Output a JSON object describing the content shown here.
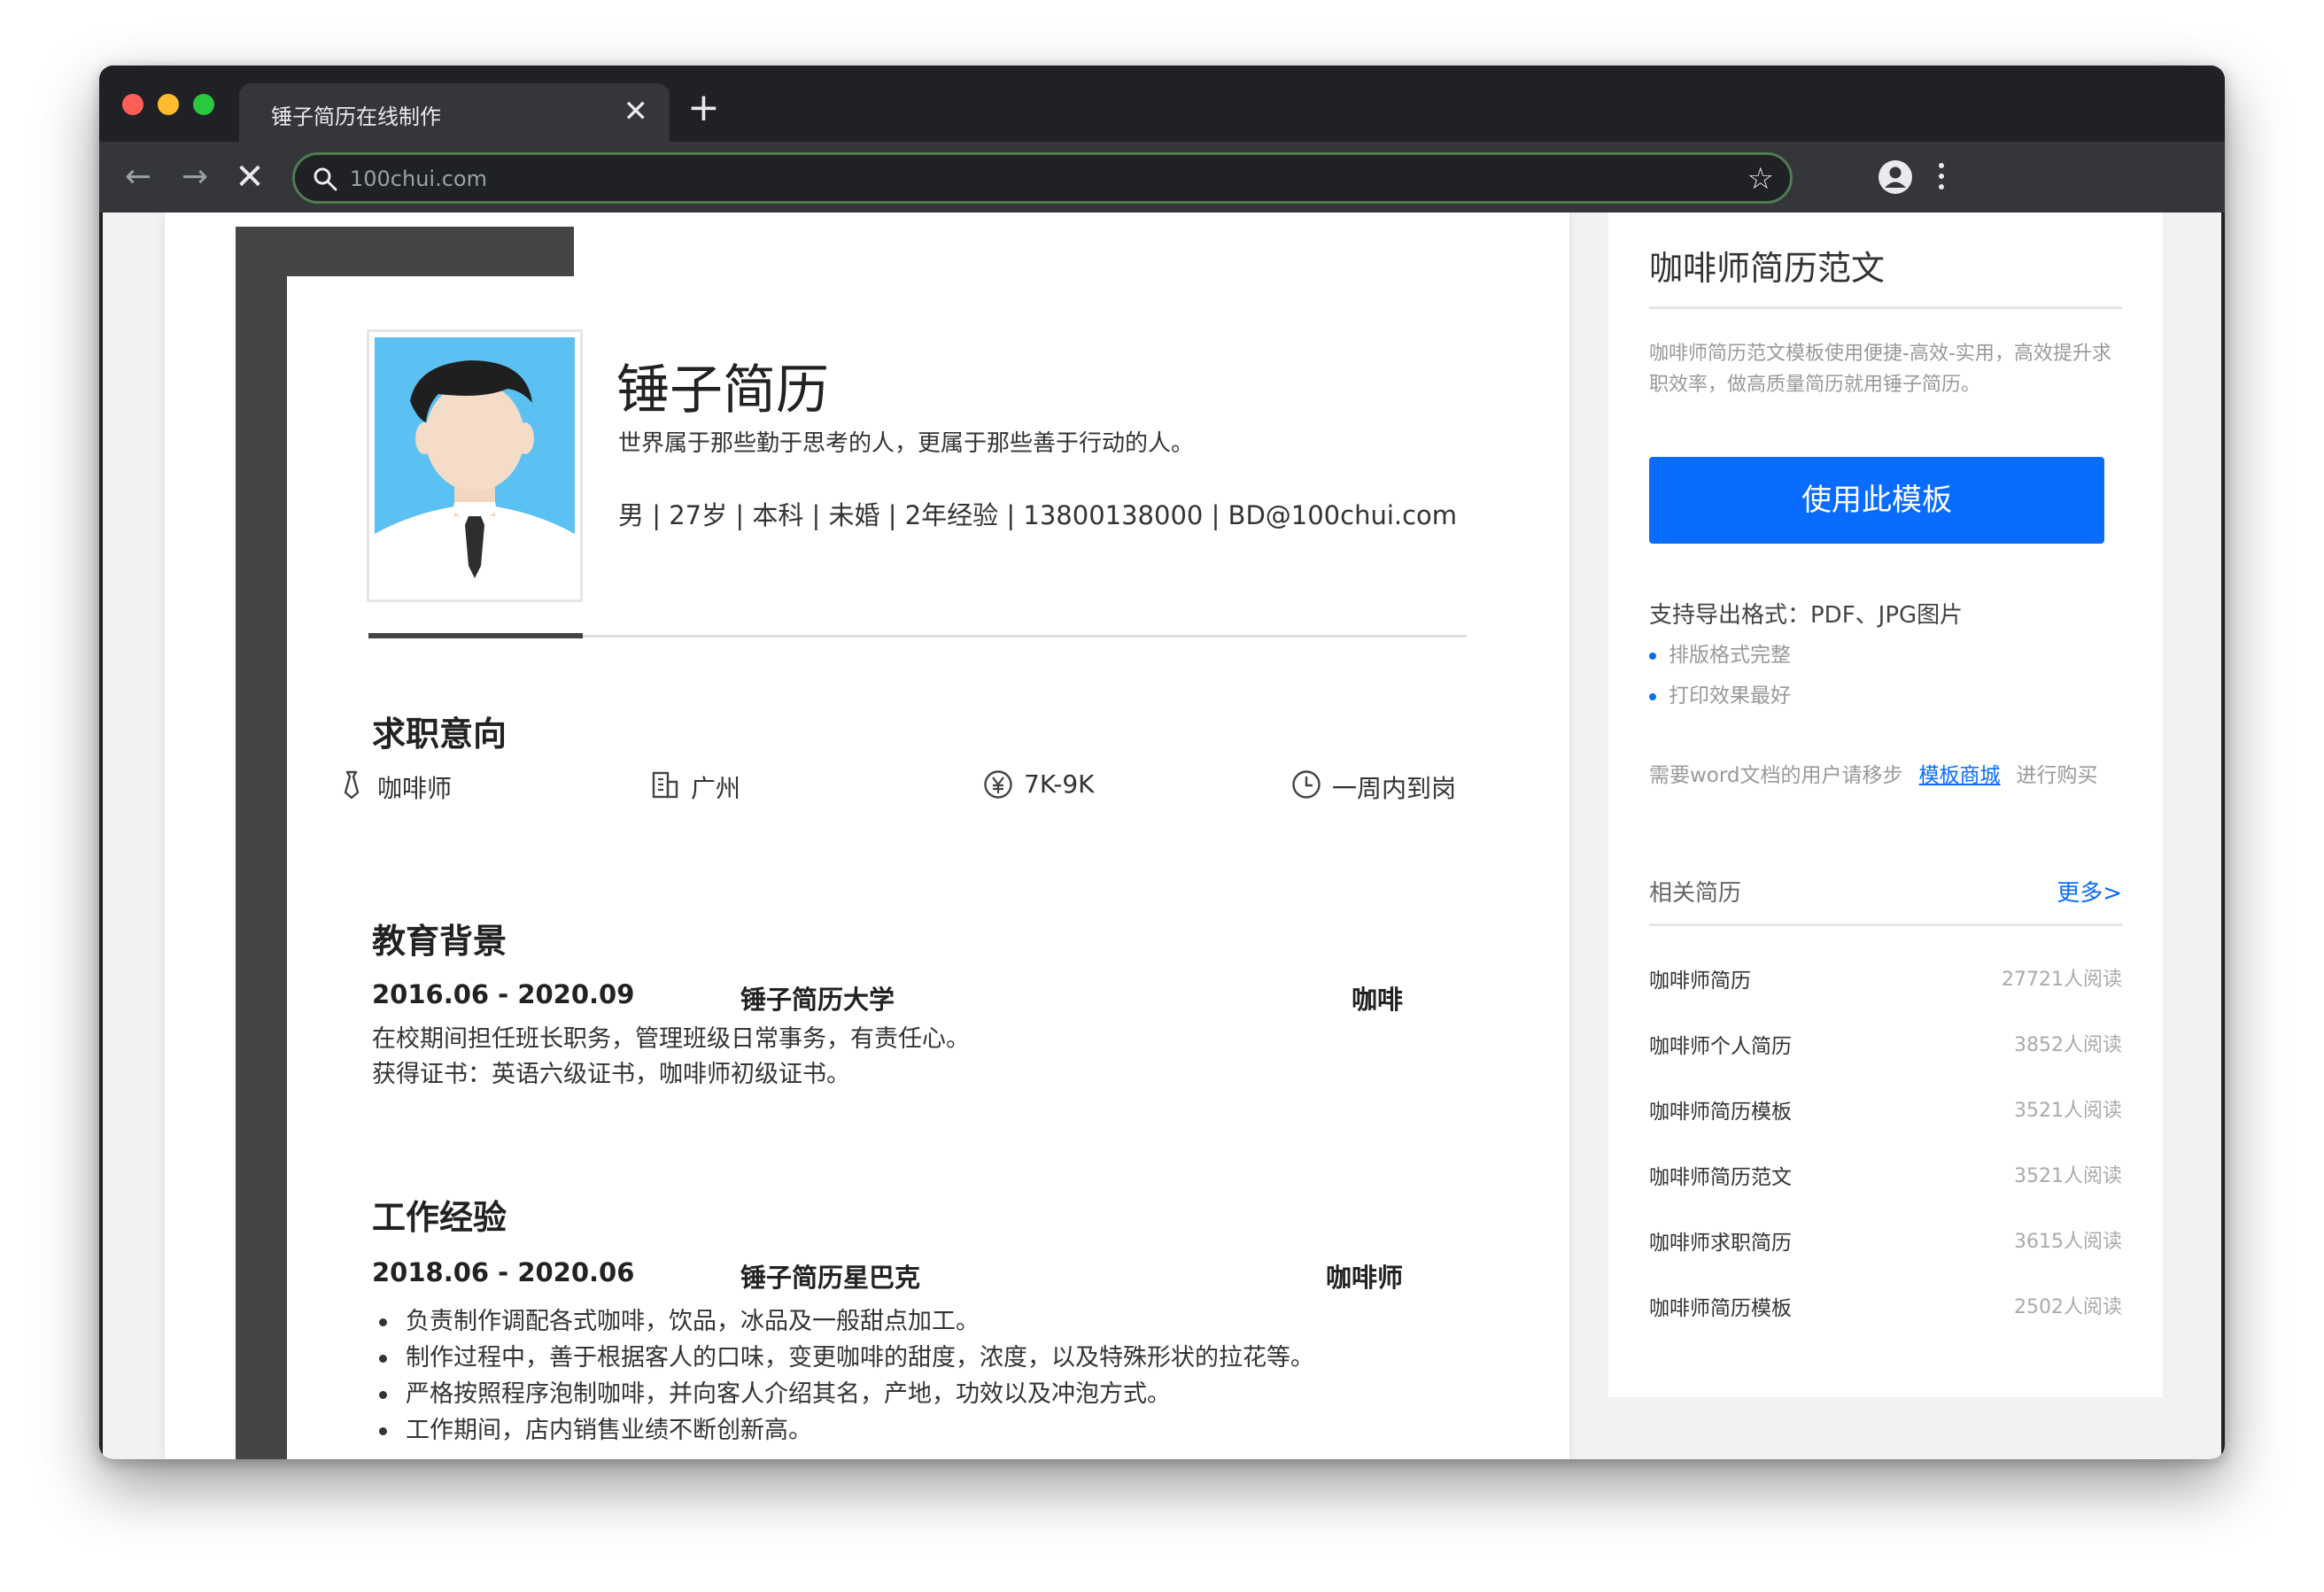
{
  "browser": {
    "tab_title": "锤子简历在线制作",
    "tab_close": "✕",
    "new_tab": "+",
    "url": "100chui.com",
    "back": "←",
    "forward": "→",
    "stop": "✕",
    "bookmark": "☆"
  },
  "resume": {
    "name": "锤子简历",
    "motto": "世界属于那些勤于思考的人，更属于那些善于行动的人。",
    "info": "男 | 27岁 | 本科 | 未婚 | 2年经验 | 13800138000 | BD@100chui.com",
    "intent_title": "求职意向",
    "intent": {
      "position": "咖啡师",
      "city": "广州",
      "salary": "7K-9K",
      "availability": "一周内到岗"
    },
    "education_title": "教育背景",
    "education": {
      "date": "2016.06 - 2020.09",
      "school": "锤子简历大学",
      "major": "咖啡",
      "line1": "在校期间担任班长职务，管理班级日常事务，有责任心。",
      "line2": "获得证书：英语六级证书，咖啡师初级证书。"
    },
    "work_title": "工作经验",
    "work": {
      "date": "2018.06 - 2020.06",
      "company": "锤子简历星巴克",
      "role": "咖啡师",
      "bullets": [
        "负责制作调配各式咖啡，饮品，冰品及一般甜点加工。",
        "制作过程中，善于根据客人的口味，变更咖啡的甜度，浓度，以及特殊形状的拉花等。",
        "严格按照程序泡制咖啡，并向客人介绍其名，产地，功效以及冲泡方式。",
        "工作期间，店内销售业绩不断创新高。"
      ]
    }
  },
  "sidebar": {
    "title": "咖啡师简历范文",
    "desc": "咖啡师简历范文模板使用便捷-高效-实用，高效提升求职效率，做高质量简历就用锤子简历。",
    "use_button": "使用此模板",
    "export_label": "支持导出格式：PDF、JPG图片",
    "features": [
      "排版格式完整",
      "打印效果最好"
    ],
    "word_note_pre": "需要word文档的用户请移步",
    "word_note_link": "模板商城",
    "word_note_post": "进行购买",
    "related_title": "相关简历",
    "related_more": "更多>",
    "related": [
      {
        "name": "咖啡师简历",
        "reads": "27721人阅读"
      },
      {
        "name": "咖啡师个人简历",
        "reads": "3852人阅读"
      },
      {
        "name": "咖啡师简历模板",
        "reads": "3521人阅读"
      },
      {
        "name": "咖啡师简历范文",
        "reads": "3521人阅读"
      },
      {
        "name": "咖啡师求职简历",
        "reads": "3615人阅读"
      },
      {
        "name": "咖啡师简历模板",
        "reads": "2502人阅读"
      }
    ]
  },
  "colors": {
    "accent": "#0a6cff",
    "browser_frame": "#202124",
    "toolbar": "#35363a",
    "resume_band": "#454545"
  }
}
